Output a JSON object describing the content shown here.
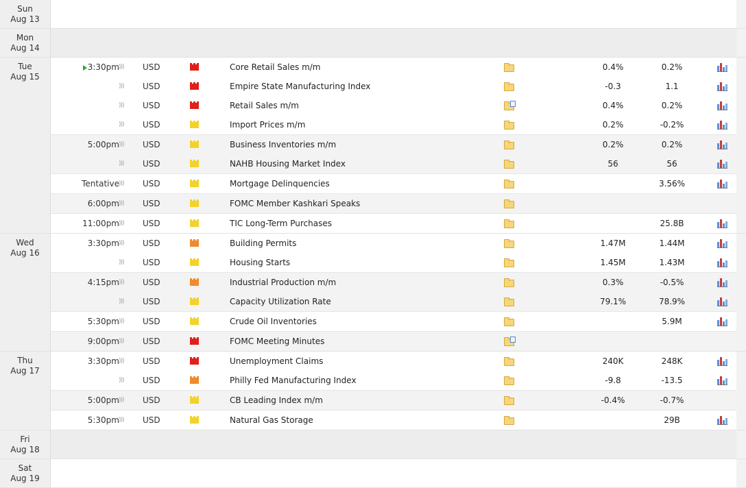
{
  "colors": {
    "impact_high": "#e0201a",
    "impact_medium": "#f08a2c",
    "impact_low": "#f3d22a",
    "now_indicator": "#2ea82e"
  },
  "days": [
    {
      "day": "Sun",
      "date": "Aug 13",
      "groups": []
    },
    {
      "day": "Mon",
      "date": "Aug 14",
      "groups": []
    },
    {
      "day": "Tue",
      "date": "Aug 15",
      "groups": [
        {
          "time": "3:30pm",
          "events": [
            {
              "currency": "USD",
              "impact": "high",
              "name": "Core Retail Sales m/m",
              "doc": false,
              "actual": "0.4%",
              "forecast": "0.2%",
              "chart": true
            },
            {
              "currency": "USD",
              "impact": "high",
              "name": "Empire State Manufacturing Index",
              "doc": false,
              "actual": "-0.3",
              "forecast": "1.1",
              "chart": true
            },
            {
              "currency": "USD",
              "impact": "high",
              "name": "Retail Sales m/m",
              "doc": true,
              "actual": "0.4%",
              "forecast": "0.2%",
              "chart": true
            },
            {
              "currency": "USD",
              "impact": "low",
              "name": "Import Prices m/m",
              "doc": false,
              "actual": "0.2%",
              "forecast": "-0.2%",
              "chart": true
            }
          ]
        },
        {
          "time": "5:00pm",
          "events": [
            {
              "currency": "USD",
              "impact": "low",
              "name": "Business Inventories m/m",
              "doc": false,
              "actual": "0.2%",
              "forecast": "0.2%",
              "chart": true
            },
            {
              "currency": "USD",
              "impact": "low",
              "name": "NAHB Housing Market Index",
              "doc": false,
              "actual": "56",
              "forecast": "56",
              "chart": true
            }
          ]
        },
        {
          "time": "Tentative",
          "events": [
            {
              "currency": "USD",
              "impact": "low",
              "name": "Mortgage Delinquencies",
              "doc": false,
              "actual": "",
              "forecast": "3.56%",
              "chart": true
            }
          ]
        },
        {
          "time": "6:00pm",
          "events": [
            {
              "currency": "USD",
              "impact": "low",
              "name": "FOMC Member Kashkari Speaks",
              "doc": false,
              "actual": "",
              "forecast": "",
              "chart": false
            }
          ]
        },
        {
          "time": "11:00pm",
          "events": [
            {
              "currency": "USD",
              "impact": "low",
              "name": "TIC Long-Term Purchases",
              "doc": false,
              "actual": "",
              "forecast": "25.8B",
              "chart": true
            }
          ]
        }
      ]
    },
    {
      "day": "Wed",
      "date": "Aug 16",
      "groups": [
        {
          "time": "3:30pm",
          "events": [
            {
              "currency": "USD",
              "impact": "med",
              "name": "Building Permits",
              "doc": false,
              "actual": "1.47M",
              "forecast": "1.44M",
              "chart": true
            },
            {
              "currency": "USD",
              "impact": "low",
              "name": "Housing Starts",
              "doc": false,
              "actual": "1.45M",
              "forecast": "1.43M",
              "chart": true
            }
          ]
        },
        {
          "time": "4:15pm",
          "events": [
            {
              "currency": "USD",
              "impact": "med",
              "name": "Industrial Production m/m",
              "doc": false,
              "actual": "0.3%",
              "forecast": "-0.5%",
              "chart": true
            },
            {
              "currency": "USD",
              "impact": "low",
              "name": "Capacity Utilization Rate",
              "doc": false,
              "actual": "79.1%",
              "forecast": "78.9%",
              "chart": true
            }
          ]
        },
        {
          "time": "5:30pm",
          "events": [
            {
              "currency": "USD",
              "impact": "low",
              "name": "Crude Oil Inventories",
              "doc": false,
              "actual": "",
              "forecast": "5.9M",
              "chart": true
            }
          ]
        },
        {
          "time": "9:00pm",
          "events": [
            {
              "currency": "USD",
              "impact": "high",
              "name": "FOMC Meeting Minutes",
              "doc": true,
              "actual": "",
              "forecast": "",
              "chart": false
            }
          ]
        }
      ]
    },
    {
      "day": "Thu",
      "date": "Aug 17",
      "groups": [
        {
          "time": "3:30pm",
          "events": [
            {
              "currency": "USD",
              "impact": "high",
              "name": "Unemployment Claims",
              "doc": false,
              "actual": "240K",
              "forecast": "248K",
              "chart": true
            },
            {
              "currency": "USD",
              "impact": "med",
              "name": "Philly Fed Manufacturing Index",
              "doc": false,
              "actual": "-9.8",
              "forecast": "-13.5",
              "chart": true
            }
          ]
        },
        {
          "time": "5:00pm",
          "events": [
            {
              "currency": "USD",
              "impact": "low",
              "name": "CB Leading Index m/m",
              "doc": false,
              "actual": "-0.4%",
              "forecast": "-0.7%",
              "chart": false
            }
          ]
        },
        {
          "time": "5:30pm",
          "events": [
            {
              "currency": "USD",
              "impact": "low",
              "name": "Natural Gas Storage",
              "doc": false,
              "actual": "",
              "forecast": "29B",
              "chart": true
            }
          ]
        }
      ]
    },
    {
      "day": "Fri",
      "date": "Aug 18",
      "groups": []
    },
    {
      "day": "Sat",
      "date": "Aug 19",
      "groups": []
    }
  ]
}
